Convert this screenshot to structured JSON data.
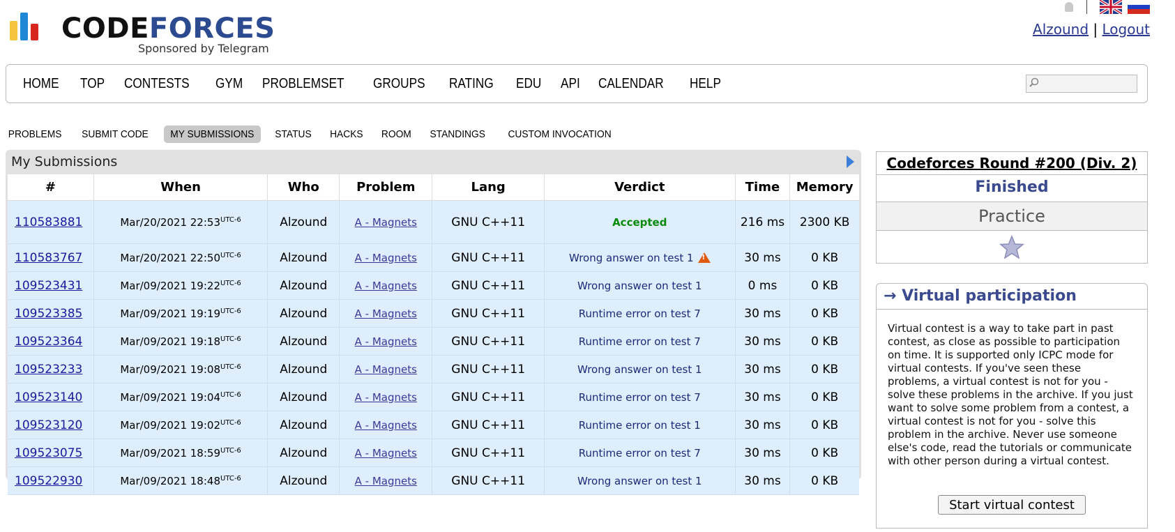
{
  "logo": {
    "word_part1": "CODE",
    "word_part2": "FORCES",
    "sponsor": "Sponsored by Telegram"
  },
  "header": {
    "user": "Alzound",
    "separator": "|",
    "logout": "Logout"
  },
  "nav": [
    "HOME",
    "TOP",
    "CONTESTS",
    "GYM",
    "PROBLEMSET",
    "GROUPS",
    "RATING",
    "EDU",
    "API",
    "CALENDAR",
    "HELP"
  ],
  "search": {
    "placeholder": ""
  },
  "submenu": [
    "PROBLEMS",
    "SUBMIT CODE",
    "MY SUBMISSIONS",
    "STATUS",
    "HACKS",
    "ROOM",
    "STANDINGS",
    "CUSTOM INVOCATION"
  ],
  "submissions": {
    "title": "My Submissions",
    "columns": [
      "#",
      "When",
      "Who",
      "Problem",
      "Lang",
      "Verdict",
      "Time",
      "Memory"
    ],
    "rows": [
      {
        "id": "110583881",
        "when": "Mar/20/2021 22:53",
        "tz": "UTC-6",
        "who": "Alzound",
        "problem": "A - Magnets",
        "lang": "GNU C++11",
        "verdict": "Accepted",
        "time": "216 ms",
        "memory": "2300 KB"
      },
      {
        "id": "110583767",
        "when": "Mar/20/2021 22:50",
        "tz": "UTC-6",
        "who": "Alzound",
        "problem": "A - Magnets",
        "lang": "GNU C++11",
        "verdict": "Wrong answer on test 1",
        "time": "30 ms",
        "memory": "0 KB"
      },
      {
        "id": "109523431",
        "when": "Mar/09/2021 19:22",
        "tz": "UTC-6",
        "who": "Alzound",
        "problem": "A - Magnets",
        "lang": "GNU C++11",
        "verdict": "Wrong answer on test 1",
        "time": "0 ms",
        "memory": "0 KB"
      },
      {
        "id": "109523385",
        "when": "Mar/09/2021 19:19",
        "tz": "UTC-6",
        "who": "Alzound",
        "problem": "A - Magnets",
        "lang": "GNU C++11",
        "verdict": "Runtime error on test 7",
        "time": "30 ms",
        "memory": "0 KB"
      },
      {
        "id": "109523364",
        "when": "Mar/09/2021 19:18",
        "tz": "UTC-6",
        "who": "Alzound",
        "problem": "A - Magnets",
        "lang": "GNU C++11",
        "verdict": "Runtime error on test 7",
        "time": "30 ms",
        "memory": "0 KB"
      },
      {
        "id": "109523233",
        "when": "Mar/09/2021 19:08",
        "tz": "UTC-6",
        "who": "Alzound",
        "problem": "A - Magnets",
        "lang": "GNU C++11",
        "verdict": "Wrong answer on test 1",
        "time": "30 ms",
        "memory": "0 KB"
      },
      {
        "id": "109523140",
        "when": "Mar/09/2021 19:04",
        "tz": "UTC-6",
        "who": "Alzound",
        "problem": "A - Magnets",
        "lang": "GNU C++11",
        "verdict": "Runtime error on test 7",
        "time": "30 ms",
        "memory": "0 KB"
      },
      {
        "id": "109523120",
        "when": "Mar/09/2021 19:02",
        "tz": "UTC-6",
        "who": "Alzound",
        "problem": "A - Magnets",
        "lang": "GNU C++11",
        "verdict": "Runtime error on test 1",
        "time": "30 ms",
        "memory": "0 KB"
      },
      {
        "id": "109523075",
        "when": "Mar/09/2021 18:59",
        "tz": "UTC-6",
        "who": "Alzound",
        "problem": "A - Magnets",
        "lang": "GNU C++11",
        "verdict": "Runtime error on test 7",
        "time": "30 ms",
        "memory": "0 KB"
      },
      {
        "id": "109522930",
        "when": "Mar/09/2021 18:48",
        "tz": "UTC-6",
        "who": "Alzound",
        "problem": "A - Magnets",
        "lang": "GNU C++11",
        "verdict": "Wrong answer on test 1",
        "time": "30 ms",
        "memory": "0 KB"
      }
    ]
  },
  "contest": {
    "title": "Codeforces Round #200 (Div. 2)",
    "status": "Finished",
    "mode": "Practice"
  },
  "virtual": {
    "title": "→ Virtual participation",
    "text": "Virtual contest is a way to take part in past contest, as close as possible to participation on time. It is supported only ICPC mode for virtual contests. If you've seen these problems, a virtual contest is not for you - solve these problems in the archive. If you just want to solve some problem from a contest, a virtual contest is not for you - solve this problem in the archive. Never use someone else's code, read the tutorials or communicate with other person during a virtual contest.",
    "button": "Start virtual contest"
  },
  "colors": {
    "accepted": "#0a8a0a",
    "verdict": "#1a2a7a",
    "accent": "#3b4a8f",
    "row_bg": "#deeefc"
  },
  "icons": {
    "bell": "bell-icon",
    "uk_flag": "uk-flag-icon",
    "ru_flag": "ru-flag-icon",
    "search": "search-icon",
    "star": "star-icon",
    "warning": "warning-icon",
    "arrow": "arrow-right-icon"
  }
}
